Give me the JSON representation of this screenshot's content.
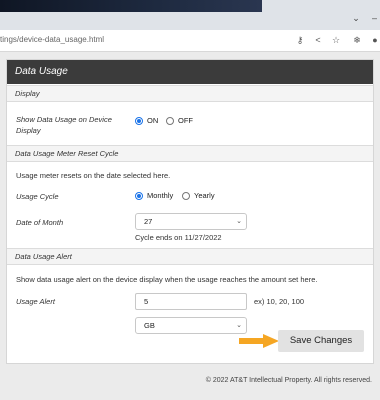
{
  "browser": {
    "url": "tings/device-data_usage.html",
    "icons": [
      "chevron-down-icon",
      "minimize-icon",
      "key-icon",
      "share-icon",
      "star-icon",
      "extension-icon",
      "profile-icon"
    ]
  },
  "panel": {
    "title": "Data Usage",
    "display": {
      "section": "Display",
      "label": "Show Data Usage on Device Display",
      "options": [
        "ON",
        "OFF"
      ],
      "selected": "ON"
    },
    "reset": {
      "section": "Data Usage Meter Reset Cycle",
      "note": "Usage meter resets on the date selected here.",
      "cycle_label": "Usage Cycle",
      "cycle_options": [
        "Monthly",
        "Yearly"
      ],
      "cycle_selected": "Monthly",
      "date_label": "Date of Month",
      "date_value": "27",
      "cycle_end": "Cycle ends on 11/27/2022"
    },
    "alert": {
      "section": "Data Usage Alert",
      "note": "Show data usage alert on the device display when the usage reaches the amount set here.",
      "label": "Usage Alert",
      "value": "5",
      "hint": "ex) 10, 20, 100",
      "unit": "GB"
    },
    "save_label": "Save Changes"
  },
  "footer": "© 2022 AT&T Intellectual Property. All rights reserved.",
  "colors": {
    "accent": "#1a73e8",
    "arrow": "#f5a623",
    "header": "#3b3b3b"
  }
}
